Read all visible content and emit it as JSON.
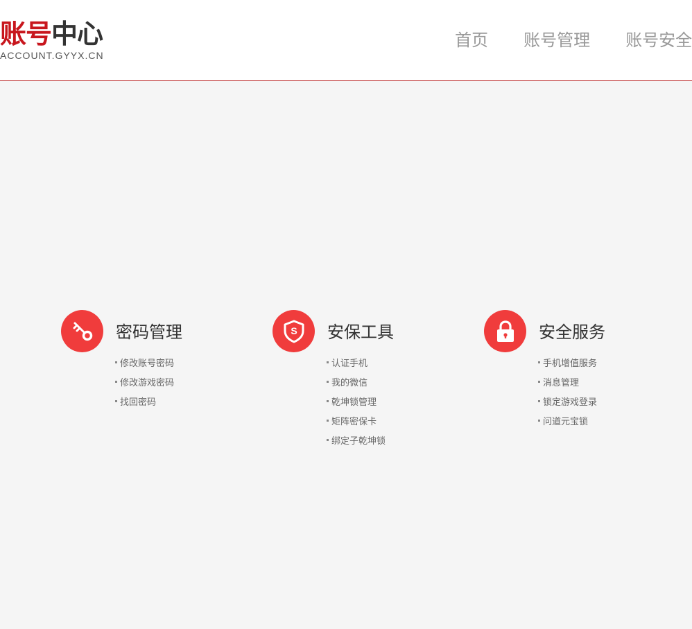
{
  "logo": {
    "title_red": "账号",
    "title_dark": "中心",
    "subtitle": "ACCOUNT.GYYX.CN"
  },
  "nav": {
    "items": [
      "首页",
      "账号管理",
      "账号安全"
    ]
  },
  "sections": [
    {
      "title": "密码管理",
      "icon": "key-icon",
      "links": [
        "修改账号密码",
        "修改游戏密码",
        "找回密码"
      ]
    },
    {
      "title": "安保工具",
      "icon": "shield-icon",
      "icon_letter": "S",
      "links": [
        "认证手机",
        "我的微信",
        "乾坤锁管理",
        "矩阵密保卡",
        "绑定子乾坤锁"
      ]
    },
    {
      "title": "安全服务",
      "icon": "lock-icon",
      "links": [
        "手机增值服务",
        "消息管理",
        "锁定游戏登录",
        "问道元宝锁"
      ]
    }
  ],
  "colors": {
    "brand_red": "#c8161d",
    "icon_circle": "#f03c3c",
    "header_border": "#b71c1c",
    "page_bg": "#f5f5f5"
  }
}
